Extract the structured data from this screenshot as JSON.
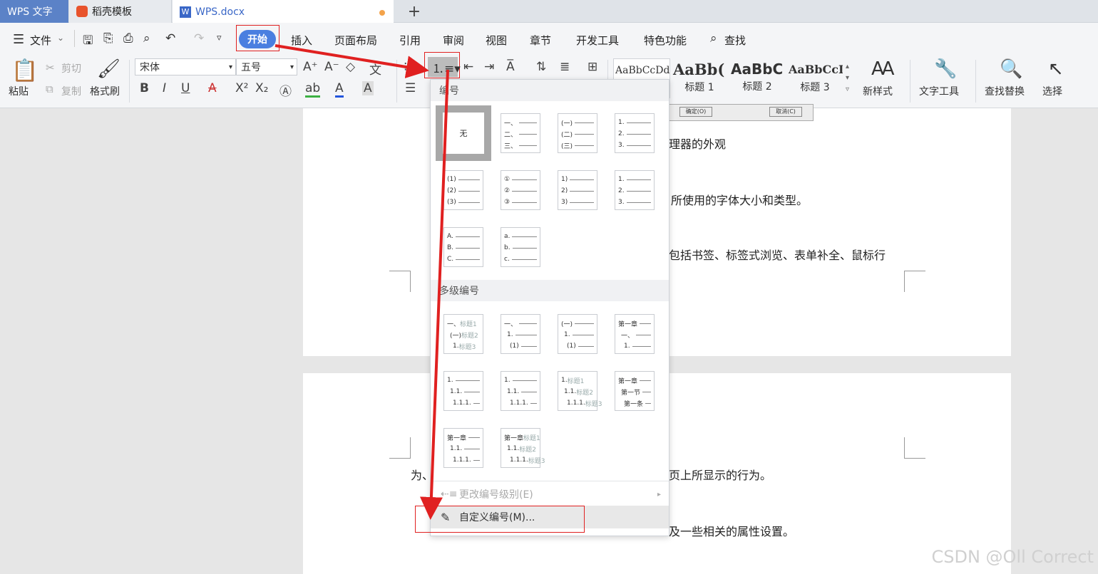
{
  "tabs": {
    "app": "WPS 文字",
    "template": "稻壳模板",
    "doc": "WPS.docx",
    "add": "+"
  },
  "menu": {
    "file": "文件",
    "items": [
      "开始",
      "插入",
      "页面布局",
      "引用",
      "审阅",
      "视图",
      "章节",
      "开发工具",
      "特色功能",
      "查找"
    ]
  },
  "ribbon": {
    "paste": "粘贴",
    "cut": "剪切",
    "copy": "复制",
    "format_painter": "格式刷",
    "font": "宋体",
    "size": "五号",
    "styles": [
      "AaBbCcDd",
      "AaBb(",
      "AaBbC",
      "AaBbCcI"
    ],
    "style_names": [
      "标题 1",
      "标题 2",
      "标题 3"
    ],
    "new_style": "新样式",
    "text_tools": "文字工具",
    "find_replace": "查找替换",
    "select": "选择"
  },
  "doc": {
    "lines": [
      "理器的外观",
      "所使用的字体大小和类型。",
      "包括书签、标签式浏览、表单补全、鼠标行",
      "为、",
      "页上所显示的行为。",
      "及一些相关的属性设置。"
    ],
    "dialog_btn": "确定(O)",
    "dialog_btn2": "取消(C)"
  },
  "dropdown": {
    "section_numbering": "编号",
    "none": "无",
    "section_multilevel": "多级编号",
    "change_level": "更改编号级别(E)",
    "custom": "自定义编号(M)...",
    "presets": [
      [
        "一、",
        "二、",
        "三、"
      ],
      [
        "(一)",
        "(二)",
        "(三)"
      ],
      [
        "1.",
        "2.",
        "3."
      ],
      [
        "(1)",
        "(2)",
        "(3)"
      ],
      [
        "①",
        "②",
        "③"
      ],
      [
        "1)",
        "2)",
        "3)"
      ],
      [
        "1.",
        "2.",
        "3."
      ],
      [
        "A.",
        "B.",
        "C."
      ],
      [
        "a.",
        "b.",
        "c."
      ]
    ],
    "multilevel": [
      [
        [
          "一、",
          "标题1"
        ],
        [
          "(一)",
          "标题2"
        ],
        [
          "1.",
          "标题3"
        ]
      ],
      [
        [
          "一、",
          ""
        ],
        [
          "1.",
          ""
        ],
        [
          "(1)",
          ""
        ]
      ],
      [
        [
          "(一)",
          ""
        ],
        [
          "1.",
          ""
        ],
        [
          "(1)",
          ""
        ]
      ],
      [
        [
          "第一章",
          ""
        ],
        [
          "一、",
          ""
        ],
        [
          "1.",
          ""
        ]
      ],
      [
        [
          "1.",
          ""
        ],
        [
          "1.1.",
          ""
        ],
        [
          "1.1.1.",
          ""
        ]
      ],
      [
        [
          "1.",
          ""
        ],
        [
          "1.1.",
          ""
        ],
        [
          "1.1.1.",
          ""
        ]
      ],
      [
        [
          "1.",
          "标题1"
        ],
        [
          "1.1.",
          "标题2"
        ],
        [
          "1.1.1.",
          "标题3"
        ]
      ],
      [
        [
          "第一章",
          ""
        ],
        [
          "第一节",
          ""
        ],
        [
          "第一条",
          ""
        ]
      ],
      [
        [
          "第一章",
          ""
        ],
        [
          "1.1.",
          ""
        ],
        [
          "1.1.1.",
          ""
        ]
      ],
      [
        [
          "第一章",
          "标题1"
        ],
        [
          "1.1.",
          "标题2"
        ],
        [
          "1.1.1.",
          "标题3"
        ]
      ]
    ]
  },
  "watermark": "CSDN @Oll Correct",
  "colors": {
    "accent": "#4a7fe0",
    "highlight": "#e02020"
  }
}
